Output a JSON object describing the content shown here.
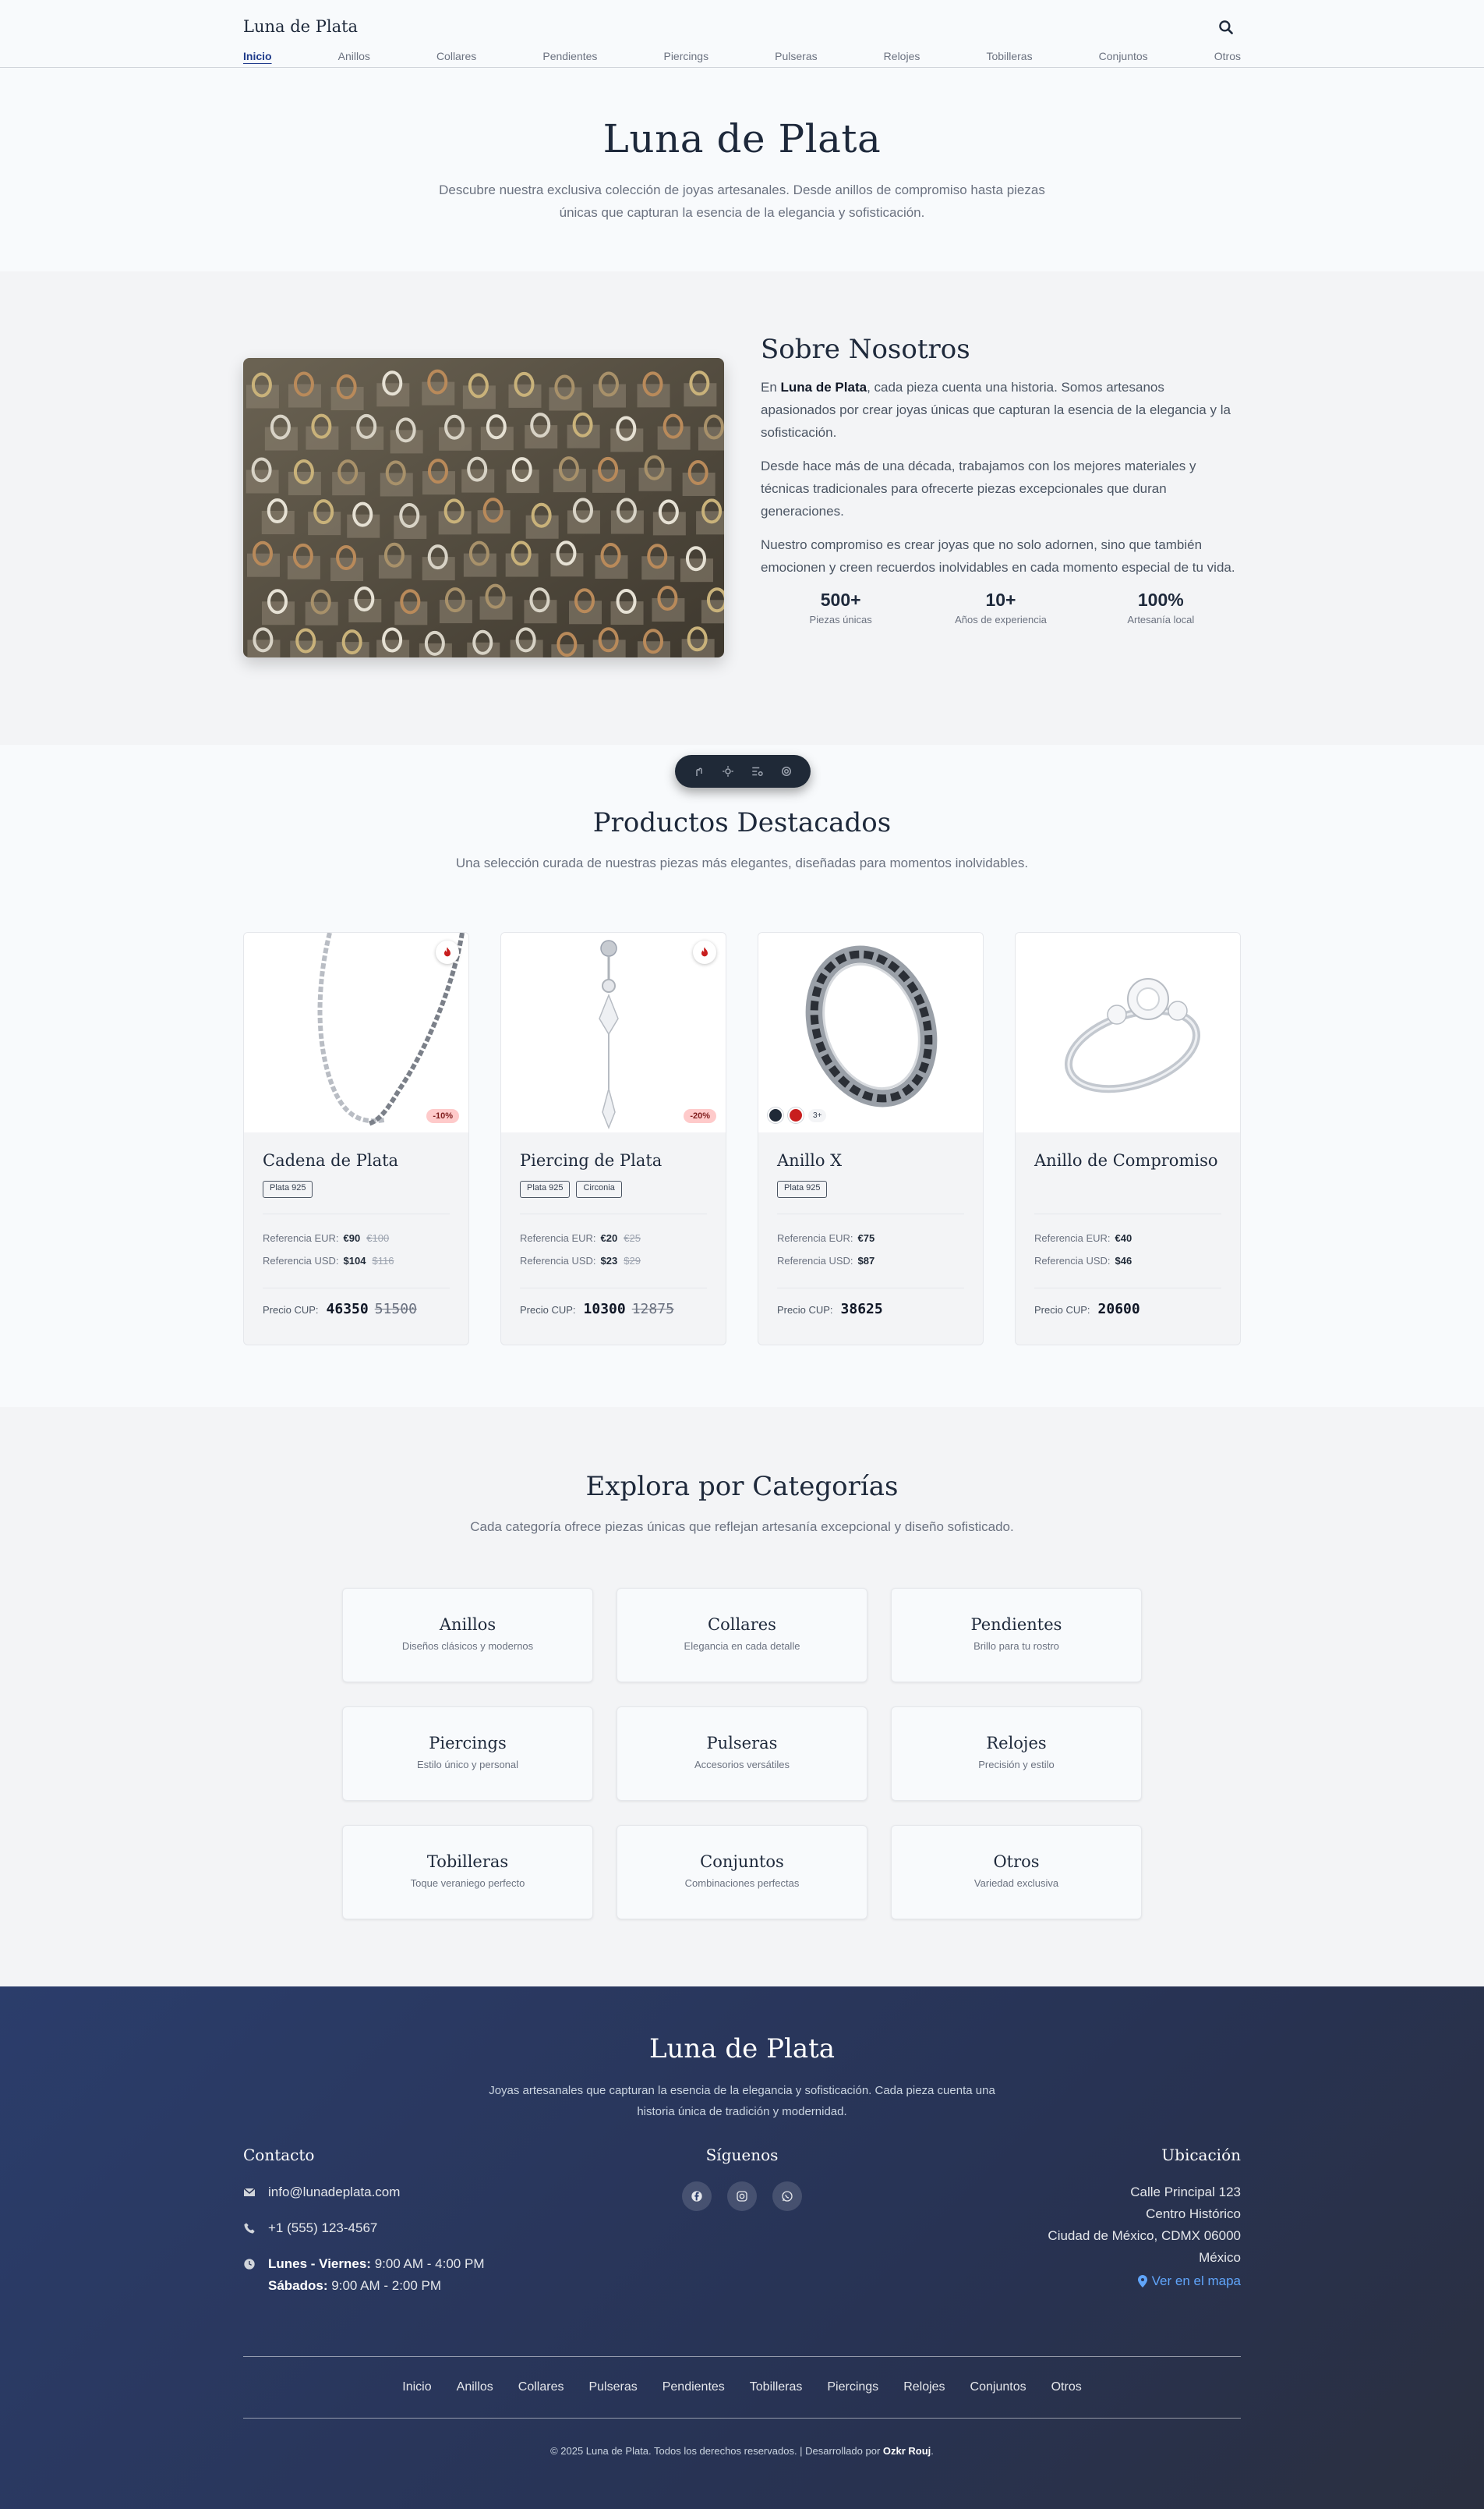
{
  "header": {
    "brand": "Luna de Plata",
    "nav": [
      "Inicio",
      "Anillos",
      "Collares",
      "Pendientes",
      "Piercings",
      "Pulseras",
      "Relojes",
      "Tobilleras",
      "Conjuntos",
      "Otros"
    ],
    "active_nav": "Inicio",
    "search_icon": "search-icon"
  },
  "hero": {
    "title": "Luna de Plata",
    "subtitle": "Descubre nuestra exclusiva colección de joyas artesanales. Desde anillos de compromiso hasta piezas únicas que capturan la esencia de la elegancia y sofisticación."
  },
  "about": {
    "title": "Sobre Nosotros",
    "p1_prefix": "En ",
    "p1_brand": "Luna de Plata",
    "p1_rest": ", cada pieza cuenta una historia. Somos artesanos apasionados por crear joyas únicas que capturan la esencia de la elegancia y la sofisticación.",
    "p2": "Desde hace más de una década, trabajamos con los mejores materiales y técnicas tradicionales para ofrecerte piezas excepcionales que duran generaciones.",
    "p3": "Nuestro compromiso es crear joyas que no solo adornen, sino que también emocionen y creen recuerdos inolvidables en cada momento especial de tu vida.",
    "stats": [
      {
        "value": "500+",
        "label": "Piezas únicas"
      },
      {
        "value": "10+",
        "label": "Años de experiencia"
      },
      {
        "value": "100%",
        "label": "Artesanía local"
      }
    ]
  },
  "toolbar": {
    "icons": [
      "cursor-icon",
      "settings-icon",
      "list-search-icon",
      "gear-icon"
    ]
  },
  "products": {
    "title": "Productos Destacados",
    "subtitle": "Una selección curada de nuestras piezas más elegantes, diseñadas para momentos inolvidables.",
    "ref_eur_label": "Referencia EUR:",
    "ref_usd_label": "Referencia USD:",
    "cup_label": "Precio CUP:",
    "items": [
      {
        "name": "Cadena de Plata",
        "tags": [
          "Plata 925"
        ],
        "hot": true,
        "discount": "-10%",
        "eur": "€90",
        "eur_old": "€100",
        "usd": "$104",
        "usd_old": "$116",
        "cup": "46350",
        "cup_old": "51500"
      },
      {
        "name": "Piercing de Plata",
        "tags": [
          "Plata 925",
          "Circonia"
        ],
        "hot": true,
        "discount": "-20%",
        "eur": "€20",
        "eur_old": "€25",
        "usd": "$23",
        "usd_old": "$29",
        "cup": "10300",
        "cup_old": "12875"
      },
      {
        "name": "Anillo X",
        "tags": [
          "Plata 925"
        ],
        "hot": false,
        "swatches": [
          "#1f2937",
          "#c81e1e"
        ],
        "more": "3+",
        "eur": "€75",
        "usd": "$87",
        "cup": "38625"
      },
      {
        "name": "Anillo de Compromiso",
        "tags": [],
        "hot": false,
        "eur": "€40",
        "usd": "$46",
        "cup": "20600"
      }
    ]
  },
  "categories": {
    "title": "Explora por Categorías",
    "subtitle": "Cada categoría ofrece piezas únicas que reflejan artesanía excepcional y diseño sofisticado.",
    "items": [
      {
        "name": "Anillos",
        "desc": "Diseños clásicos y modernos"
      },
      {
        "name": "Collares",
        "desc": "Elegancia en cada detalle"
      },
      {
        "name": "Pendientes",
        "desc": "Brillo para tu rostro"
      },
      {
        "name": "Piercings",
        "desc": "Estilo único y personal"
      },
      {
        "name": "Pulseras",
        "desc": "Accesorios versátiles"
      },
      {
        "name": "Relojes",
        "desc": "Precisión y estilo"
      },
      {
        "name": "Tobilleras",
        "desc": "Toque veraniego perfecto"
      },
      {
        "name": "Conjuntos",
        "desc": "Combinaciones perfectas"
      },
      {
        "name": "Otros",
        "desc": "Variedad exclusiva"
      }
    ]
  },
  "footer": {
    "brand": "Luna de Plata",
    "description": "Joyas artesanales que capturan la esencia de la elegancia y sofisticación. Cada pieza cuenta una historia única de tradición y modernidad.",
    "contact": {
      "title": "Contacto",
      "email": "info@lunadeplata.com",
      "phone": "+1 (555) 123-4567",
      "weekdays_label": "Lunes - Viernes:",
      "weekdays_hours": "9:00 AM - 4:00 PM",
      "saturday_label": "Sábados:",
      "saturday_hours": "9:00 AM - 2:00 PM"
    },
    "social": {
      "title": "Síguenos",
      "icons": [
        "facebook-icon",
        "instagram-icon",
        "whatsapp-icon"
      ]
    },
    "location": {
      "title": "Ubicación",
      "lines": [
        "Calle Principal 123",
        "Centro Histórico",
        "Ciudad de México, CDMX 06000",
        "México"
      ],
      "map_link": "Ver en el mapa"
    },
    "links": [
      "Inicio",
      "Anillos",
      "Collares",
      "Pulseras",
      "Pendientes",
      "Tobilleras",
      "Piercings",
      "Relojes",
      "Conjuntos",
      "Otros"
    ],
    "copyright_prefix": "© 2025 Luna de Plata. Todos los derechos reservados. | Desarrollado por ",
    "developer": "Ozkr Rouj",
    "copyright_suffix": "."
  },
  "colors": {
    "accent": "#1e3a8a",
    "footer_bg": "#283354",
    "hot_red": "#c81e1e",
    "discount_bg": "#fecaca",
    "map_link": "#60a5fa"
  }
}
